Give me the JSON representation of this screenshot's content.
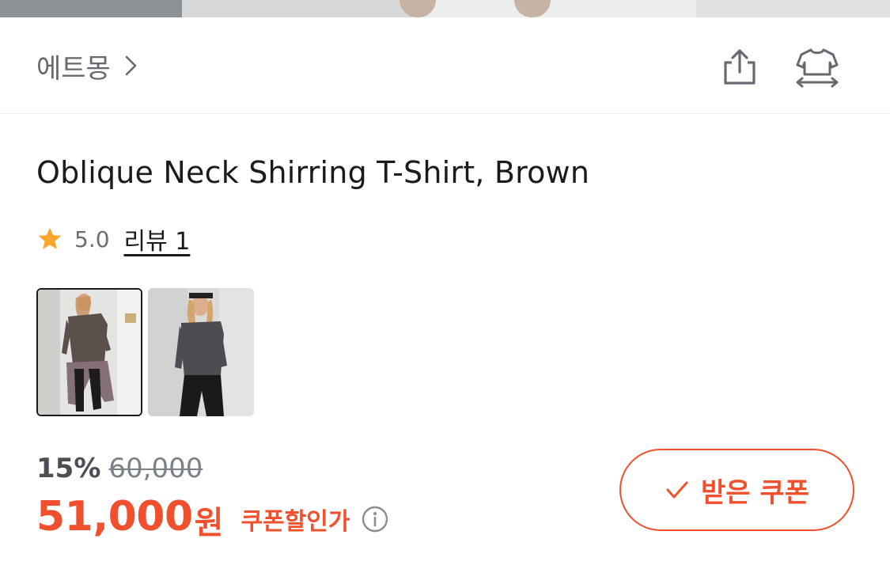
{
  "brand": {
    "name": "에트몽"
  },
  "header_icons": [
    "share-icon",
    "size-guide-icon"
  ],
  "product": {
    "title": "Oblique Neck Shirring T-Shirt, Brown",
    "rating": "5.0",
    "review_label": "리뷰 1"
  },
  "price": {
    "discount_rate": "15%",
    "original_price": "60,000",
    "final_price": "51,000",
    "final_unit": "원",
    "coupon_price_label": "쿠폰할인가"
  },
  "coupon_button": {
    "label": "받은 쿠폰",
    "icon": "check-icon"
  },
  "colors": {
    "accent": "#f0502d",
    "text_muted": "#666a70",
    "star": "#fba72d"
  }
}
